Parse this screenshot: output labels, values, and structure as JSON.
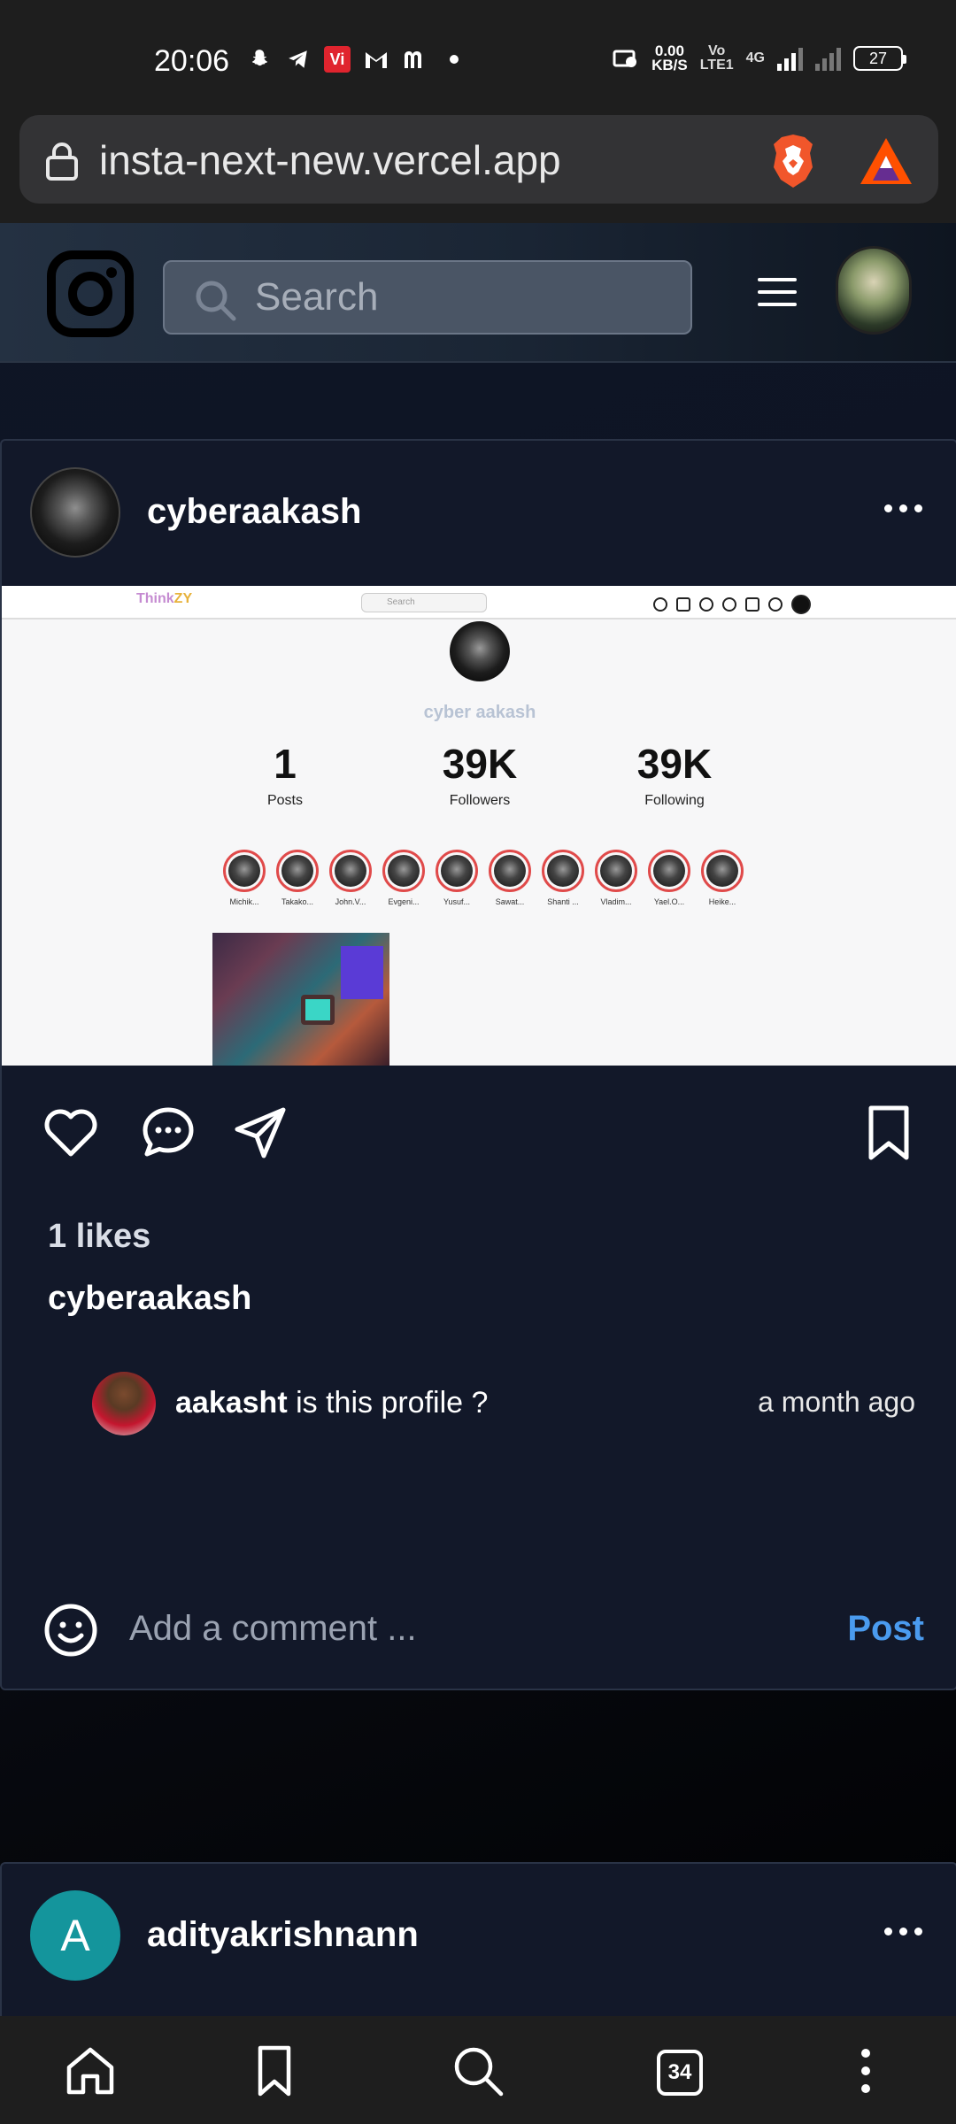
{
  "status_bar": {
    "time": "20:06",
    "speed_value": "0.00",
    "speed_unit": "KB/S",
    "volte_top": "Vo",
    "volte_bottom": "LTE1",
    "network": "4G",
    "battery": "27"
  },
  "browser": {
    "url": "insta-next-new.vercel.app"
  },
  "header": {
    "search_placeholder": "Search"
  },
  "post": {
    "username": "cyberaakash",
    "likes": "1 likes",
    "caption_username": "cyberaakash",
    "image": {
      "brand_prefix": "Think",
      "brand_suffix": "ZY",
      "search_placeholder": "Search",
      "profile_name": "cyber aakash",
      "stats": [
        {
          "value": "1",
          "label": "Posts"
        },
        {
          "value": "39K",
          "label": "Followers"
        },
        {
          "value": "39K",
          "label": "Following"
        }
      ],
      "stories": [
        "Michik...",
        "Takako...",
        "John.V...",
        "Evgeni...",
        "Yusuf...",
        "Sawat...",
        "Shanti ...",
        "Vladim...",
        "Yael.O...",
        "Heike..."
      ]
    },
    "comment": {
      "username": "aakasht",
      "text": " is this profile ?",
      "time": "a month ago"
    },
    "comment_placeholder": "Add a comment ...",
    "post_button": "Post"
  },
  "post2": {
    "avatar_letter": "A",
    "username": "adityakrishnann"
  },
  "bottom_nav": {
    "tabs_count": "34"
  },
  "colors": {
    "accent": "#4a9bef",
    "card_bg": "#121829",
    "avatar_teal": "#14959c"
  }
}
